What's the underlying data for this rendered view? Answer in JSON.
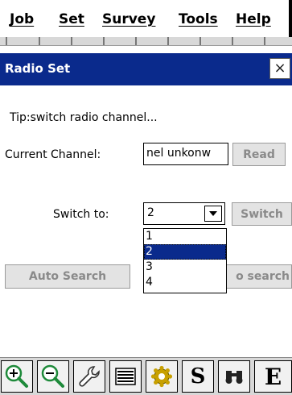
{
  "menu": {
    "items": [
      {
        "label": "Job"
      },
      {
        "label": "Set"
      },
      {
        "label": "Survey"
      },
      {
        "label": "Tools"
      },
      {
        "label": "Help"
      }
    ]
  },
  "dialog": {
    "title": "Radio Set",
    "close_glyph": "×",
    "tip": "Tip:switch radio channel...",
    "current_channel_label": "Current Channel:",
    "current_channel_value": "nel unkonw",
    "read_button": "Read",
    "switch_to_label": "Switch to:",
    "switch_value": "2",
    "switch_button": "Switch",
    "options": [
      "1",
      "2",
      "3",
      "4"
    ],
    "selected_option": "2",
    "auto_search_button": "Auto Search",
    "stop_search_button": "o search"
  },
  "toolbar": {
    "icons": [
      "zoom-in-icon",
      "zoom-out-icon",
      "wrench-icon",
      "list-icon",
      "gear-icon",
      "s-icon",
      "binoculars-icon",
      "e-icon"
    ],
    "s_glyph": "S",
    "e_glyph": "E"
  },
  "colors": {
    "titlebar": "#0a2a8c",
    "selection": "#0a2a8c",
    "zoom": "#1e8a3a",
    "gear": "#c8a000"
  }
}
